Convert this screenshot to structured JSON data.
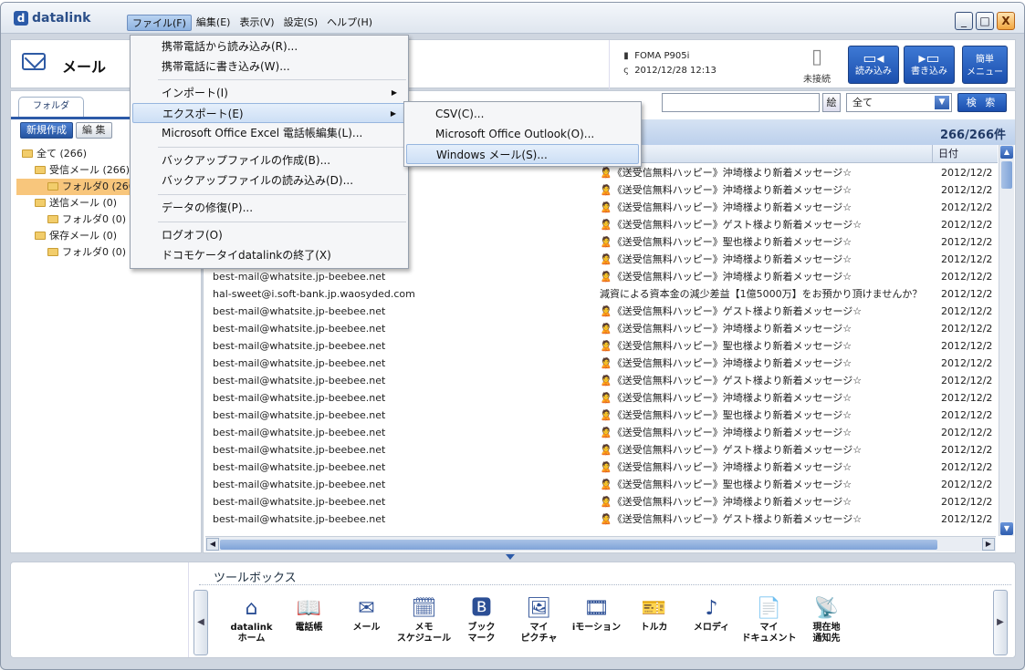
{
  "app": {
    "title": "datalink"
  },
  "menubar": [
    {
      "label": "ファイル(F)",
      "active": true
    },
    {
      "label": "編集(E)"
    },
    {
      "label": "表示(V)"
    },
    {
      "label": "設定(S)"
    },
    {
      "label": "ヘルプ(H)"
    }
  ],
  "window_controls": {
    "minimize": "_",
    "maximize": "□",
    "close": "X"
  },
  "header": {
    "title": "メール",
    "device_model": "FOMA P905i",
    "device_date": "2012/12/28 12:13",
    "connection_status": "未接続",
    "read_button": "読み込み",
    "write_button": "書き込み",
    "simple_menu_button_1": "簡単",
    "simple_menu_button_2": "メニュー"
  },
  "left": {
    "tab": "フォルダ",
    "new_button": "新規作成",
    "edit_button": "編 集",
    "tree": [
      {
        "label": "全て (266)",
        "indent": 0
      },
      {
        "label": "受信メール (266)",
        "indent": 1
      },
      {
        "label": "フォルダ0 (266",
        "indent": 2,
        "selected": true
      },
      {
        "label": "送信メール (0)",
        "indent": 1
      },
      {
        "label": "フォルダ0 (0)",
        "indent": 2
      },
      {
        "label": "保存メール (0)",
        "indent": 1
      },
      {
        "label": "フォルダ0 (0)",
        "indent": 2
      }
    ]
  },
  "search": {
    "mini_label": "絵",
    "select_value": "全て",
    "button": "検 索"
  },
  "list": {
    "count": "266/266件",
    "date_header": "日付",
    "rows": [
      {
        "from": "",
        "subject": "🙎《送受信無料ハッピー》沖埼様より新着メッセージ☆",
        "date": "2012/12/2"
      },
      {
        "from": "",
        "subject": "🙎《送受信無料ハッピー》沖埼様より新着メッセージ☆",
        "date": "2012/12/2"
      },
      {
        "from": "",
        "subject": "🙎《送受信無料ハッピー》沖埼様より新着メッセージ☆",
        "date": "2012/12/2"
      },
      {
        "from": "",
        "subject": "🙎《送受信無料ハッピー》ゲスト様より新着メッセージ☆",
        "date": "2012/12/2"
      },
      {
        "from": "",
        "subject": "🙎《送受信無料ハッピー》聖也様より新着メッセージ☆",
        "date": "2012/12/2"
      },
      {
        "from": "",
        "subject": "🙎《送受信無料ハッピー》沖埼様より新着メッセージ☆",
        "date": "2012/12/2"
      },
      {
        "from": "best-mail@whatsite.jp-beebee.net",
        "subject": "🙎《送受信無料ハッピー》沖埼様より新着メッセージ☆",
        "date": "2012/12/2"
      },
      {
        "from": "hal-sweet@i.soft-bank.jp.waosyded.com",
        "subject": "減資による資本金の減少差益【1億5000万】をお預かり頂けませんか？",
        "date": "2012/12/2"
      },
      {
        "from": "best-mail@whatsite.jp-beebee.net",
        "subject": "🙎《送受信無料ハッピー》ゲスト様より新着メッセージ☆",
        "date": "2012/12/2"
      },
      {
        "from": "best-mail@whatsite.jp-beebee.net",
        "subject": "🙎《送受信無料ハッピー》沖埼様より新着メッセージ☆",
        "date": "2012/12/2"
      },
      {
        "from": "best-mail@whatsite.jp-beebee.net",
        "subject": "🙎《送受信無料ハッピー》聖也様より新着メッセージ☆",
        "date": "2012/12/2"
      },
      {
        "from": "best-mail@whatsite.jp-beebee.net",
        "subject": "🙎《送受信無料ハッピー》沖埼様より新着メッセージ☆",
        "date": "2012/12/2"
      },
      {
        "from": "best-mail@whatsite.jp-beebee.net",
        "subject": "🙎《送受信無料ハッピー》ゲスト様より新着メッセージ☆",
        "date": "2012/12/2"
      },
      {
        "from": "best-mail@whatsite.jp-beebee.net",
        "subject": "🙎《送受信無料ハッピー》沖埼様より新着メッセージ☆",
        "date": "2012/12/2"
      },
      {
        "from": "best-mail@whatsite.jp-beebee.net",
        "subject": "🙎《送受信無料ハッピー》聖也様より新着メッセージ☆",
        "date": "2012/12/2"
      },
      {
        "from": "best-mail@whatsite.jp-beebee.net",
        "subject": "🙎《送受信無料ハッピー》沖埼様より新着メッセージ☆",
        "date": "2012/12/2"
      },
      {
        "from": "best-mail@whatsite.jp-beebee.net",
        "subject": "🙎《送受信無料ハッピー》ゲスト様より新着メッセージ☆",
        "date": "2012/12/2"
      },
      {
        "from": "best-mail@whatsite.jp-beebee.net",
        "subject": "🙎《送受信無料ハッピー》沖埼様より新着メッセージ☆",
        "date": "2012/12/2"
      },
      {
        "from": "best-mail@whatsite.jp-beebee.net",
        "subject": "🙎《送受信無料ハッピー》聖也様より新着メッセージ☆",
        "date": "2012/12/2"
      },
      {
        "from": "best-mail@whatsite.jp-beebee.net",
        "subject": "🙎《送受信無料ハッピー》沖埼様より新着メッセージ☆",
        "date": "2012/12/2"
      },
      {
        "from": "best-mail@whatsite.jp-beebee.net",
        "subject": "🙎《送受信無料ハッピー》ゲスト様より新着メッセージ☆",
        "date": "2012/12/2"
      }
    ]
  },
  "file_menu": [
    {
      "label": "携帯電話から読み込み(R)..."
    },
    {
      "label": "携帯電話に書き込み(W)..."
    },
    {
      "label": "インポート(I)",
      "submenu": true
    },
    {
      "label": "エクスポート(E)",
      "submenu": true,
      "highlighted": true
    },
    {
      "label": "Microsoft Office Excel 電話帳編集(L)..."
    },
    {
      "label": "バックアップファイルの作成(B)..."
    },
    {
      "label": "バックアップファイルの読み込み(D)..."
    },
    {
      "label": "データの修復(P)..."
    },
    {
      "label": "ログオフ(O)"
    },
    {
      "label": "ドコモケータイdatalinkの終了(X)"
    }
  ],
  "export_submenu": [
    {
      "label": "CSV(C)..."
    },
    {
      "label": "Microsoft Office Outlook(O)..."
    },
    {
      "label": "Windows メール(S)...",
      "highlighted": true
    }
  ],
  "toolbox": {
    "title": "ツールボックス",
    "tools": [
      {
        "line1": "datalink",
        "line2": "ホーム",
        "icon": "home-icon",
        "glyph": "⌂"
      },
      {
        "line1": "電話帳",
        "line2": "",
        "icon": "phonebook-icon",
        "glyph": "📖"
      },
      {
        "line1": "メール",
        "line2": "",
        "icon": "mail-icon",
        "glyph": "✉"
      },
      {
        "line1": "メモ",
        "line2": "スケジュール",
        "icon": "schedule-icon",
        "glyph": "🗓"
      },
      {
        "line1": "ブック",
        "line2": "マーク",
        "icon": "bookmark-icon",
        "glyph": "🅱"
      },
      {
        "line1": "マイ",
        "line2": "ピクチャ",
        "icon": "picture-icon",
        "glyph": "🖼"
      },
      {
        "line1": "iモーション",
        "line2": "",
        "icon": "film-icon",
        "glyph": "🎞"
      },
      {
        "line1": "トルカ",
        "line2": "",
        "icon": "toruca-icon",
        "glyph": "🎫"
      },
      {
        "line1": "メロディ",
        "line2": "",
        "icon": "music-icon",
        "glyph": "♪"
      },
      {
        "line1": "マイ",
        "line2": "ドキュメント",
        "icon": "pdf-icon",
        "glyph": "📄"
      },
      {
        "line1": "現在地",
        "line2": "通知先",
        "icon": "location-icon",
        "glyph": "📡"
      }
    ]
  }
}
